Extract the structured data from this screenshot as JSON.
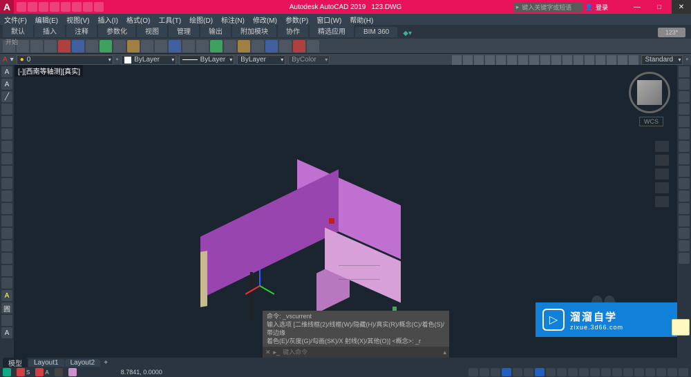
{
  "title": {
    "app": "Autodesk AutoCAD 2019",
    "doc": "123.DWG"
  },
  "search": {
    "placeholder": "键入关键字或短语"
  },
  "user": {
    "label": "登录"
  },
  "menu": [
    "文件(F)",
    "编辑(E)",
    "视图(V)",
    "插入(I)",
    "格式(O)",
    "工具(T)",
    "绘图(D)",
    "标注(N)",
    "修改(M)",
    "参数(P)",
    "窗口(W)",
    "帮助(H)"
  ],
  "tabs": [
    "默认",
    "插入",
    "注释",
    "参数化",
    "视图",
    "管理",
    "输出",
    "附加模块",
    "协作",
    "精选应用",
    "BIM 360"
  ],
  "panel": {
    "label": "开始"
  },
  "doc_tab": {
    "label": "123*"
  },
  "properties": {
    "layer": "0",
    "color": "ByLayer",
    "linetype": "ByLayer",
    "lineweight": "ByLayer",
    "plotstyle": "ByColor",
    "style": "Standard"
  },
  "viewport": {
    "label": "[-][西南等轴测][真实]"
  },
  "wcs": {
    "label": "WCS"
  },
  "command": {
    "hist1": "命令: _vscurrent",
    "hist2": "输入选项 [二维线框(2)/线框(W)/隐藏(H)/真实(R)/概念(C)/着色(S)/带边缘",
    "hist3": "着色(E)/灰度(G)/勾画(SK)/X 射线(X)/其他(O)] <概念>: _r",
    "placeholder": "键入命令"
  },
  "layouts": [
    "模型",
    "Layout1",
    "Layout2"
  ],
  "status": {
    "coords": "8.7841, 0.0000"
  },
  "watermark": {
    "main": "溜溜自学",
    "sub": "zixue.3d66.com"
  },
  "left_tools": [
    "A",
    "A",
    "",
    "",
    "",
    "",
    "",
    "",
    "",
    "",
    "",
    "",
    "",
    "",
    "",
    "",
    "",
    "",
    "A",
    "圓",
    "",
    "A",
    ""
  ],
  "right_tools": [
    "",
    "",
    "",
    "",
    "",
    "",
    "",
    "",
    "",
    "",
    "",
    "",
    "",
    "",
    "",
    "",
    "",
    ""
  ]
}
